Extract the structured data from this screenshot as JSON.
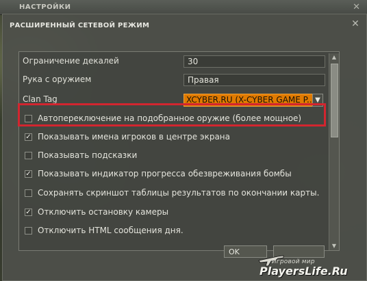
{
  "outer_window": {
    "title": "НАСТРОЙКИ",
    "close_glyph": "✕"
  },
  "dialog": {
    "title": "РАСШИРЕННЫЙ СЕТЕВОЙ РЕЖИМ",
    "close_glyph": "✕"
  },
  "settings": {
    "decal_limit": {
      "label": "Ограничение декалей",
      "value": "30"
    },
    "weapon_hand": {
      "label": "Рука с оружием",
      "value": "Правая"
    },
    "clan_tag": {
      "label": "Clan Tag",
      "value": "XCYBER.RU (X-CYBER GAME P..."
    },
    "highlight_color": "#d3252f",
    "combo_color": "#e07a00"
  },
  "checkboxes": [
    {
      "label": "Автопереключение на подобранное оружие (более мощное)",
      "checked": false
    },
    {
      "label": "Показывать имена игроков в центре экрана",
      "checked": true
    },
    {
      "label": "Показывать подсказки",
      "checked": false
    },
    {
      "label": "Показывать индикатор прогресса обезвреживания бомбы",
      "checked": true
    },
    {
      "label": "Сохранять скриншот таблицы результатов по окончании карты.",
      "checked": false
    },
    {
      "label": "Отключить остановку камеры",
      "checked": true
    },
    {
      "label": "Отключить HTML сообщения дня.",
      "checked": false
    }
  ],
  "buttons": {
    "ok": "OK"
  },
  "watermark": {
    "top": "Игровой мир",
    "main": "PlayersLife.Ru"
  }
}
